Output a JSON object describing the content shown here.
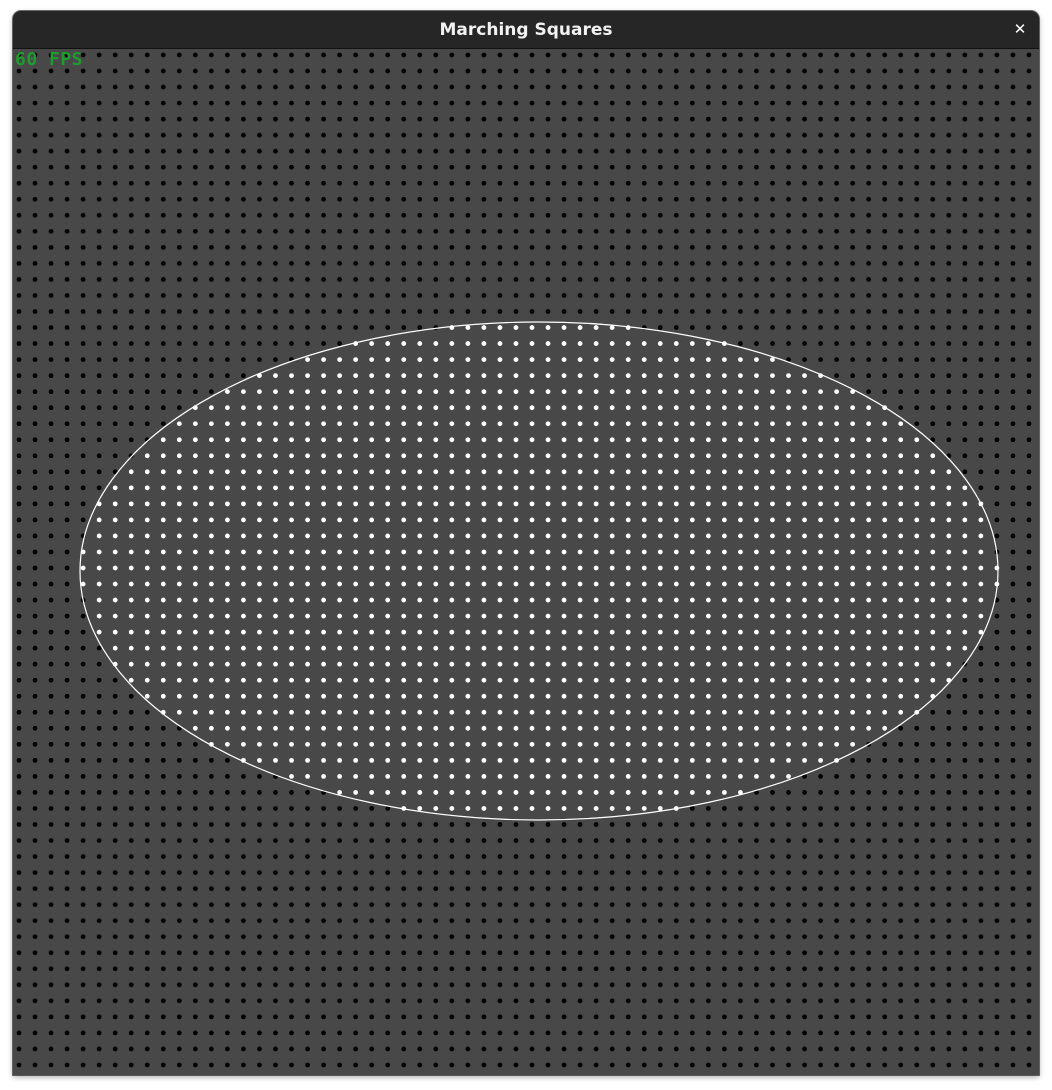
{
  "window": {
    "title": "Marching Squares",
    "close_glyph": "✕"
  },
  "overlay": {
    "fps_text": "60 FPS",
    "fps_color": "#1f9b2f"
  },
  "simulation": {
    "grid_columns": 64,
    "grid_rows": 64,
    "background_color": "#484848",
    "inactive_point_color": "#000000",
    "active_point_color": "#ffffff",
    "contour_color": "#ffffff",
    "shape": "ellipse"
  }
}
